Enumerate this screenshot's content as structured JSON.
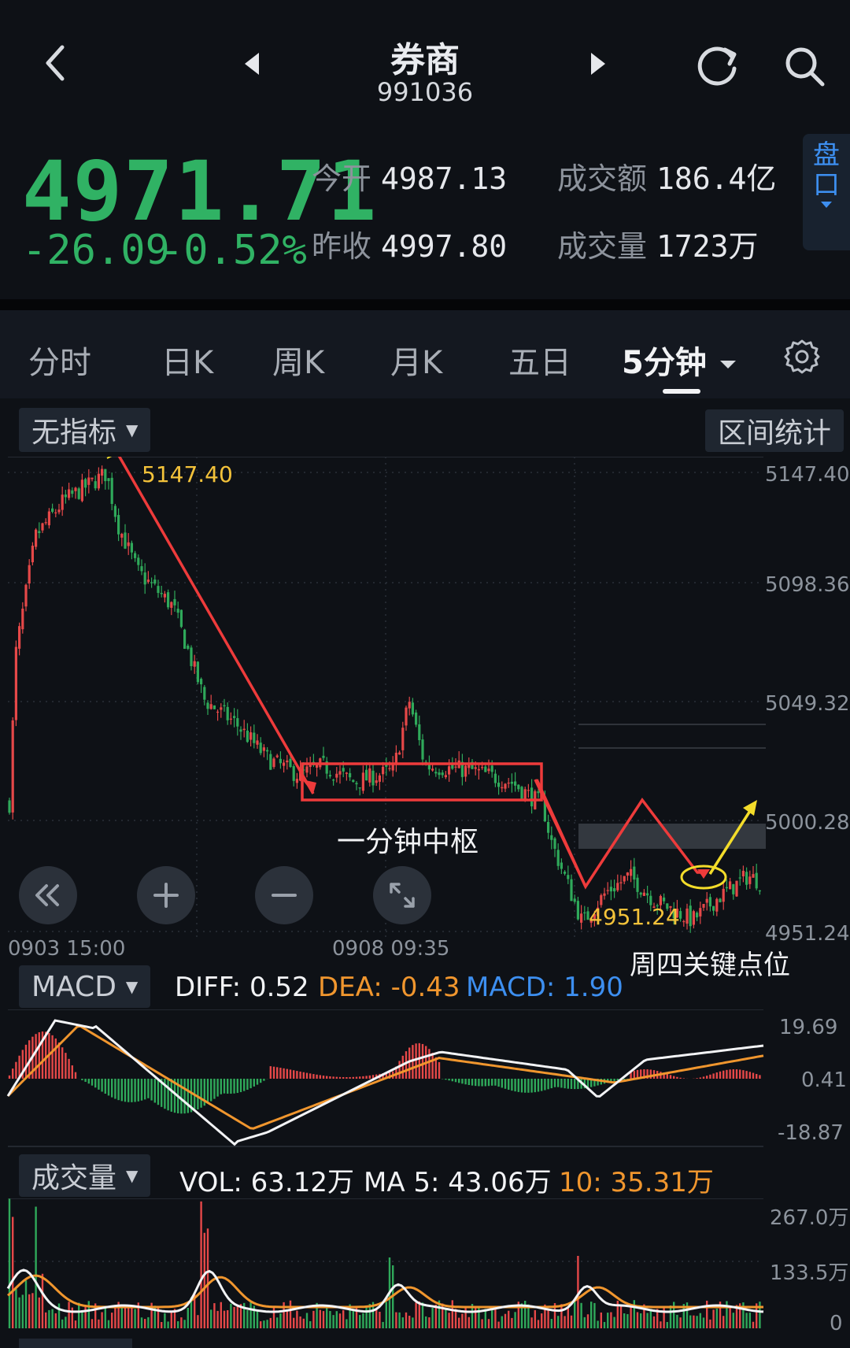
{
  "header": {
    "title": "券商",
    "code": "991036"
  },
  "quote": {
    "price": "4971.71",
    "change": "-26.09",
    "change_pct": "-0.52%",
    "open_label": "今开",
    "open_value": "4987.13",
    "prev_close_label": "昨收",
    "prev_close_value": "4997.80",
    "turnover_label": "成交额",
    "turnover_value": "186.4亿",
    "volume_label": "成交量",
    "volume_value": "1723万",
    "side_tab": [
      "盘",
      "口"
    ]
  },
  "tabs": [
    {
      "label": "分时",
      "active": false
    },
    {
      "label": "日K",
      "active": false
    },
    {
      "label": "周K",
      "active": false
    },
    {
      "label": "月K",
      "active": false
    },
    {
      "label": "五日",
      "active": false
    },
    {
      "label": "5分钟",
      "active": true
    }
  ],
  "chart": {
    "indicator_label": "无指标",
    "range_stats_label": "区间统计",
    "price_axis": [
      "5147.40",
      "5098.36",
      "5049.32",
      "5000.28",
      "4951.24"
    ],
    "time_axis": [
      "0903  15:00",
      "0908  09:35"
    ],
    "high_label": "5147.40",
    "low_label": "4951.24",
    "annotation_box": "一分钟中枢",
    "annotation_key": "周四关键点位"
  },
  "macd": {
    "label": "MACD",
    "diff": "DIFF: 0.52",
    "dea": "DEA: -0.43",
    "macd": "MACD: 1.90",
    "axis": [
      "19.69",
      "0.41",
      "-18.87"
    ]
  },
  "volume": {
    "label": "成交量",
    "vol": "VOL: 63.12万",
    "ma5": "MA 5: 43.06万",
    "ma10": "10: 35.31万",
    "axis": [
      "267.0万",
      "133.5万",
      "0"
    ]
  },
  "colors": {
    "up": "#e54848",
    "down": "#2fa95a",
    "white": "#f2f3f5",
    "orange": "#f0962e",
    "blue": "#3d8ff0",
    "annot_red": "#ee3b3b",
    "annot_yellow": "#f3dc2a"
  },
  "icons": [
    "back-icon",
    "prev-icon",
    "next-icon",
    "refresh-icon",
    "search-icon",
    "settings-icon",
    "rewind-icon",
    "zoom-in-icon",
    "zoom-out-icon",
    "fullscreen-icon"
  ],
  "chart_data": {
    "type": "candlestick",
    "price_range": [
      4951.24,
      5147.4
    ],
    "macd_range": [
      -18.87,
      19.69
    ],
    "volume_range": [
      0,
      267.0
    ],
    "high": 5147.4,
    "low": 4951.24
  }
}
